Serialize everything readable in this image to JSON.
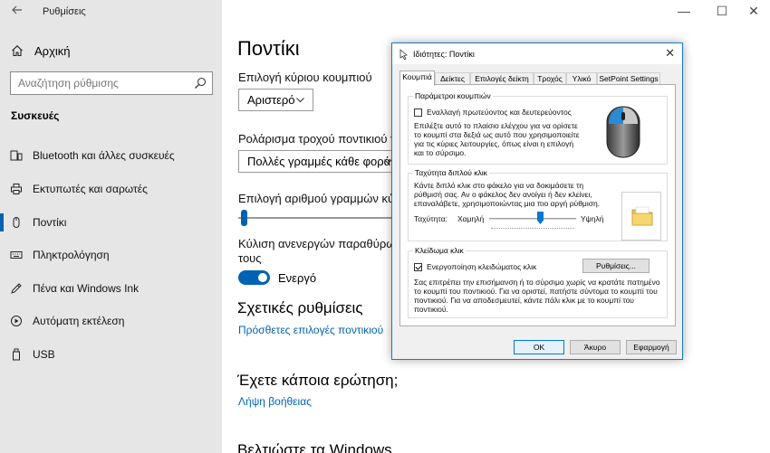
{
  "settings": {
    "window_title": "Ρυθμίσεις",
    "back_icon": "back-arrow-icon",
    "home_label": "Αρχική",
    "search_placeholder": "Αναζήτηση ρύθμισης",
    "section_label": "Συσκευές",
    "nav_items": [
      {
        "label": "Bluetooth και άλλες συσκευές",
        "icon": "bluetooth-icon"
      },
      {
        "label": "Εκτυπωτές και σαρωτές",
        "icon": "printer-icon"
      },
      {
        "label": "Ποντίκι",
        "icon": "mouse-icon",
        "selected": true
      },
      {
        "label": "Πληκτρολόγηση",
        "icon": "keyboard-icon"
      },
      {
        "label": "Πένα και Windows Ink",
        "icon": "pen-icon"
      },
      {
        "label": "Αυτόματη εκτέλεση",
        "icon": "autoplay-icon"
      },
      {
        "label": "USB",
        "icon": "usb-icon"
      }
    ],
    "window_controls": {
      "minimize": "—",
      "maximize": "☐",
      "close": "✕"
    },
    "accent_color": "#0063b1",
    "main": {
      "title": "Ποντίκι",
      "primary_button_label": "Επιλογή κύριου κουμπιού",
      "primary_button_value": "Αριστερό",
      "wheel_label": "Ρολάρισμα τροχού ποντικιού για",
      "wheel_value": "Πολλές γραμμές κάθε φορά",
      "lines_label": "Επιλογή αριθμού γραμμών κύλισης",
      "lines_slider_fraction": 0.02,
      "inactive_scroll_label_line1": "Κύλιση ανενεργών παραθύρων όταν",
      "inactive_scroll_label_line2": "τους",
      "toggle_state": "Ενεργό",
      "related_heading": "Σχετικές ρυθμίσεις",
      "related_link": "Πρόσθετες επιλογές ποντικιού",
      "question_heading": "Έχετε κάποια ερώτηση;",
      "help_link": "Λήψη βοήθειας",
      "improve_heading": "Βελτιώστε τα Windows"
    }
  },
  "dialog": {
    "title": "Ιδιότητες: Ποντίκι",
    "tabs": [
      "Κουμπιά",
      "Δείκτες",
      "Επιλογές δείκτη",
      "Τροχός",
      "Υλικό",
      "SetPoint Settings"
    ],
    "active_tab": 0,
    "buttons_group": {
      "title": "Παράμετροι κουμπιών",
      "swap_label": "Εναλλαγή πρωτεύοντος και δευτερεύοντος",
      "swap_checked": false,
      "description": "Επιλέξτε αυτό το πλαίσιο ελέγχου για να ορίσετε το κουμπί στα δεξιά ως αυτό που χρησιμοποιείτε για τις κύριες λειτουργίες, όπως είναι η επιλογή και το σύρσιμο."
    },
    "dblclick_group": {
      "title": "Ταχύτητα διπλού κλικ",
      "description": "Κάντε διπλό κλικ στο φάκελο για να δοκιμάσετε τη ρύθμισή σας. Αν ο φάκελος δεν ανοίγει ή δεν κλείνει, επαναλάβετε, χρησιμοποιώντας μια πιο αργή ρύθμιση.",
      "speed_label": "Ταχύτητα:",
      "slow_label": "Χαμηλή",
      "fast_label": "Υψηλή",
      "speed_fraction": 0.55
    },
    "clicklock_group": {
      "title": "Κλείδωμα κλικ",
      "enable_label": "Ενεργοποίηση κλειδώματος κλικ",
      "enable_checked": true,
      "settings_button": "Ρυθμίσεις...",
      "description": "Σας επιτρέπει την επισήμανση ή το σύρσιμο χωρίς να κρατάτε πατημένο το κουμπί του ποντικιού. Για να οριστεί, πατήστε σύντομα το κουμπί του ποντικιού. Για να αποδεσμευτεί, κάντε πάλι κλικ με το κουμπί του ποντικιού."
    },
    "ok_button": "OK",
    "cancel_button": "Άκυρο",
    "apply_button": "Εφαρμογή",
    "close_icon": "✕"
  }
}
